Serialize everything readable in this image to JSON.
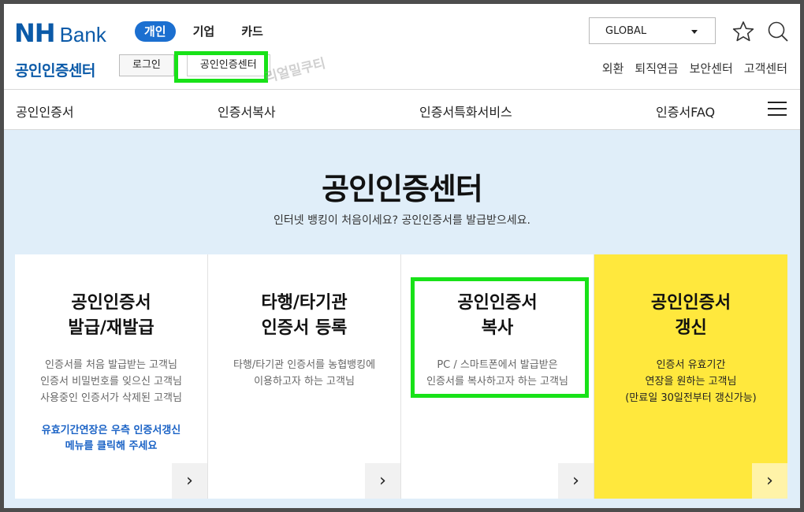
{
  "header": {
    "logo_nh": "NH",
    "logo_bank": "Bank",
    "segments": [
      "개인",
      "기업",
      "카드"
    ],
    "global_select": "GLOBAL",
    "star_icon": "star-icon",
    "search_icon": "search-icon"
  },
  "sub": {
    "title": "공인인증센터",
    "login_label": "로그인",
    "cert_center_label": "공인인증센터",
    "watermark": "리얼밀쿠티",
    "links": [
      "외환",
      "퇴직연금",
      "보안센터",
      "고객센터"
    ]
  },
  "gnb": {
    "items": [
      "공인인증서",
      "인증서복사",
      "인증서특화서비스",
      "인증서FAQ"
    ]
  },
  "hero": {
    "title": "공인인증센터",
    "subtitle": "인터넷 뱅킹이 처음이세요? 공인인증서를 발급받으세요."
  },
  "cards": [
    {
      "title": "공인인증서\n발급/재발급",
      "desc": "인증서를 처음 발급받는 고객님\n인증서 비밀번호를 잊으신 고객님\n사용중인 인증서가 삭제된 고객님",
      "note": "유효기간연장은 우측 인증서갱신\n메뉴를 클릭해 주세요",
      "arrow": "›"
    },
    {
      "title": "타행/타기관\n인증서 등록",
      "desc": "타행/타기관 인증서를 농협뱅킹에\n이용하고자 하는 고객님",
      "arrow": "›"
    },
    {
      "title": "공인인증서\n복사",
      "desc": "PC / 스마트폰에서 발급받은\n인증서를 복사하고자 하는 고객님",
      "arrow": "›"
    },
    {
      "title": "공인인증서\n갱신",
      "desc": "인증서 유효기간\n연장을 원하는 고객님\n(만료일 30일전부터 갱신가능)",
      "arrow": "›"
    }
  ],
  "colors": {
    "brand_blue": "#0b5aa8",
    "active_tab": "#1b6fd0",
    "highlight_green": "#18e218",
    "hero_bg": "#e0eef9",
    "yellow_card": "#ffe83d"
  }
}
